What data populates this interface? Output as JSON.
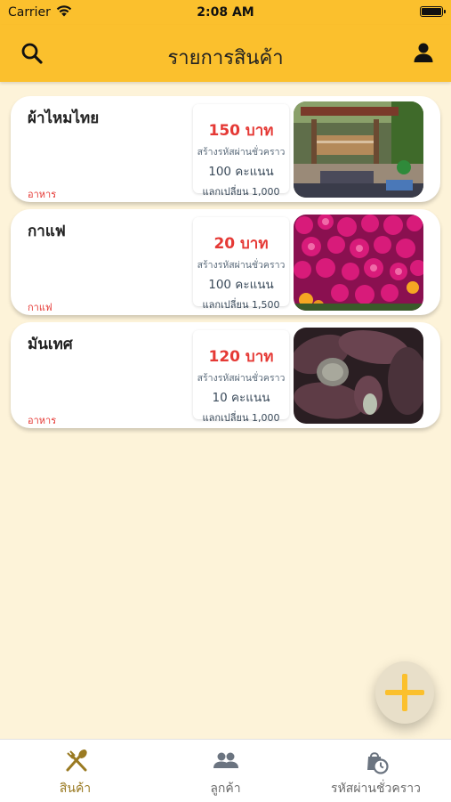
{
  "status_bar": {
    "carrier": "Carrier",
    "time": "2:08 AM"
  },
  "nav": {
    "title": "รายการสินค้า",
    "left_icon": "search-icon",
    "right_icon": "person-icon"
  },
  "products": [
    {
      "name": "ผ้าไหมไทย",
      "category": "อาหาร",
      "price": "150 บาท",
      "temp_code": "สร้างรหัสผ่านชั่วคราว",
      "points": "100 คะแนน",
      "exchange": "แลกเปลี่ยน 1,000",
      "photo": "loom-shed-photo"
    },
    {
      "name": "กาแฟ",
      "category": "กาแฟ",
      "price": "20 บาท",
      "temp_code": "สร้างรหัสผ่านชั่วคราว",
      "points": "100 คะแนน",
      "exchange": "แลกเปลี่ยน 1,500",
      "photo": "magenta-flowers-photo"
    },
    {
      "name": "มันเทศ",
      "category": "อาหาร",
      "price": "120 บาท",
      "temp_code": "สร้างรหัสผ่านชั่วคราว",
      "points": "10 คะแนน",
      "exchange": "แลกเปลี่ยน 1,000",
      "photo": "sweet-potatoes-photo"
    }
  ],
  "fab": {
    "icon": "plus-icon"
  },
  "tabs": [
    {
      "label": "สินค้า",
      "icon": "fork-spoon-icon",
      "active": true
    },
    {
      "label": "ลูกค้า",
      "icon": "people-icon",
      "active": false
    },
    {
      "label": "รหัสผ่านชั่วคราว",
      "icon": "bag-clock-icon",
      "active": false
    }
  ],
  "colors": {
    "header": "#fbc02d",
    "background": "#fdf3d9",
    "price": "#e53935",
    "active_tab": "#9a7a22",
    "fab_plus": "#fbc02d"
  }
}
